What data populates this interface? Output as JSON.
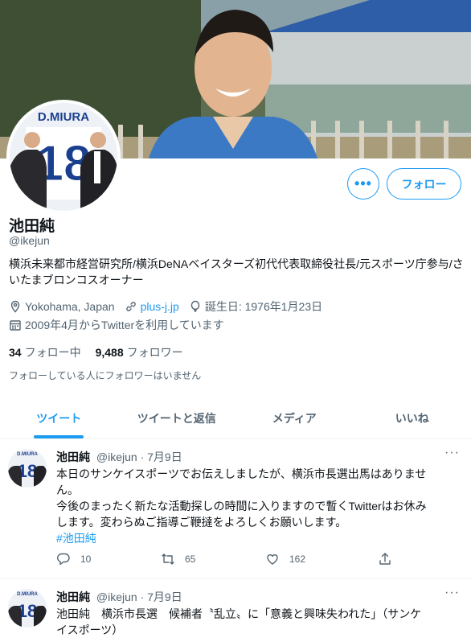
{
  "profile": {
    "name": "池田純",
    "handle": "@ikejun",
    "bio": "横浜未来都市経営研究所/横浜DeNAベイスターズ初代代表取締役社長/元スポーツ庁参与/さいたまブロンコスオーナー",
    "location": "Yokohama, Japan",
    "website": "plus-j.jp",
    "birthday": "誕生日: 1976年1月23日",
    "joined": "2009年4月からTwitterを利用しています",
    "following_count": "34",
    "following_label": "フォロー中",
    "followers_count": "9,488",
    "followers_label": "フォロワー",
    "mutual_note": "フォローしている人にフォロワーはいません",
    "follow_button": "フォロー",
    "more_button": "•••",
    "avatar_jersey_name": "D.MIURA",
    "avatar_jersey_number": "18"
  },
  "tabs": [
    {
      "label": "ツイート",
      "active": true
    },
    {
      "label": "ツイートと返信",
      "active": false
    },
    {
      "label": "メディア",
      "active": false
    },
    {
      "label": "いいね",
      "active": false
    }
  ],
  "tweets": [
    {
      "name": "池田純",
      "handle": "@ikejun",
      "date": "· 7月9日",
      "lines": [
        "本日のサンケイスポーツでお伝えしましたが、横浜市長選出馬はありませ",
        "ん。",
        "今後のまったく新たな活動探しの時間に入りますので暫くTwitterはお休み",
        "します。変わらぬご指導ご鞭撻をよろしくお願いします。"
      ],
      "hashtag": "#池田純",
      "replies": "10",
      "retweets": "65",
      "likes": "162"
    },
    {
      "name": "池田純",
      "handle": "@ikejun",
      "date": "· 7月9日",
      "lines": [
        "池田純　横浜市長選　候補者〝乱立〟に「意義と興味失われた」（サンケ",
        "イスポーツ）"
      ]
    }
  ],
  "colors": {
    "accent": "#1d9bf0",
    "text": "#0f1419",
    "muted": "#536471"
  }
}
